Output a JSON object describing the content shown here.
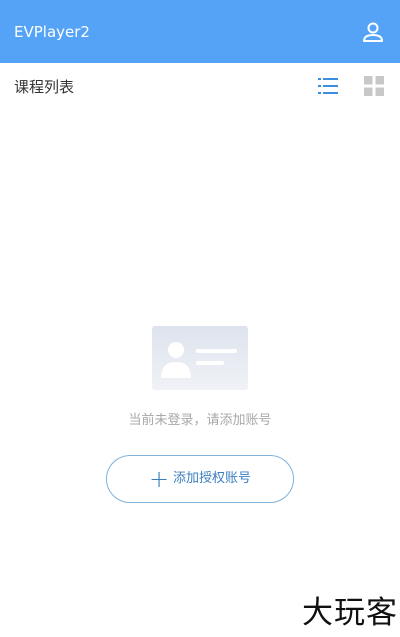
{
  "app": {
    "title": "EVPlayer2"
  },
  "toolbar": {
    "account_icon": "person-icon"
  },
  "course_list": {
    "title": "课程列表",
    "view_modes": [
      "list-view-icon",
      "grid-view-icon"
    ],
    "active_view": "list"
  },
  "empty_state": {
    "illustration_icon": "id-card-icon",
    "message": "当前未登录，请添加账号",
    "add_button_label": "添加授权账号"
  },
  "watermark": {
    "text": "大玩客"
  },
  "colors": {
    "appbar": "#55a3f6",
    "accent": "#3c7fc0",
    "button_border": "#7fb1db",
    "muted_text": "#a8a8a8",
    "inactive_icon": "#c8c8c8"
  }
}
